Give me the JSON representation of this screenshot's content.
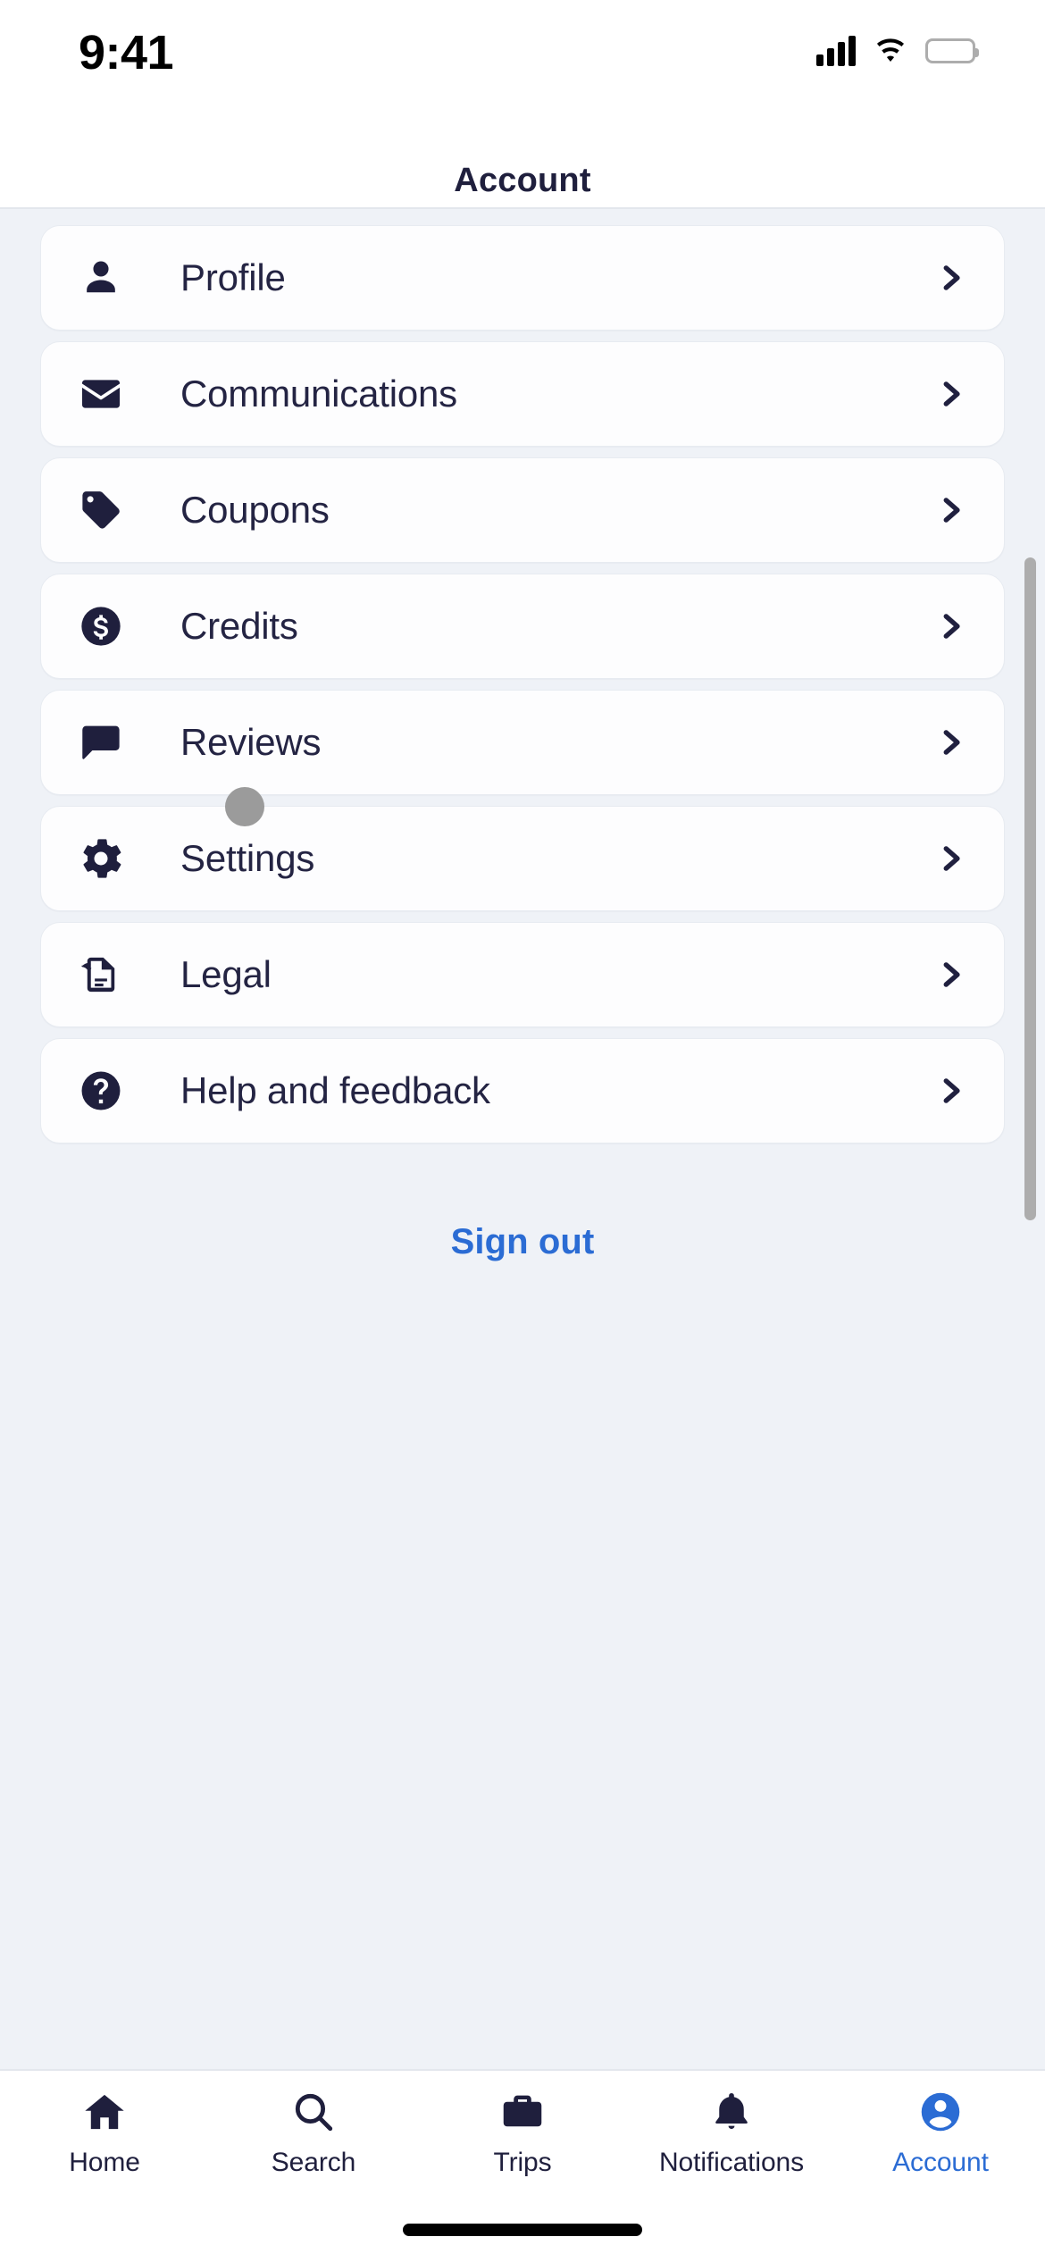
{
  "status_bar": {
    "time": "9:41",
    "signal_icon": "cellular-signal-icon",
    "wifi_icon": "wifi-icon",
    "battery_icon": "battery-full-icon"
  },
  "header": {
    "title": "Account"
  },
  "colors": {
    "accent_blue": "#2b6cd4",
    "ink_navy": "#1f1f3d",
    "page_bg": "#eff2f7",
    "card_bg": "#fdfdfe",
    "card_border": "#e7ebf1",
    "tap_indicator": "#9b9b9b"
  },
  "menu": {
    "items": [
      {
        "label": "Profile",
        "icon": "person-icon",
        "chevron": "chevron-right-icon"
      },
      {
        "label": "Communications",
        "icon": "envelope-icon",
        "chevron": "chevron-right-icon"
      },
      {
        "label": "Coupons",
        "icon": "price-tag-icon",
        "chevron": "chevron-right-icon"
      },
      {
        "label": "Credits",
        "icon": "dollar-circle-icon",
        "chevron": "chevron-right-icon"
      },
      {
        "label": "Reviews",
        "icon": "speech-bubble-icon",
        "chevron": "chevron-right-icon"
      },
      {
        "label": "Settings",
        "icon": "gear-icon",
        "chevron": "chevron-right-icon"
      },
      {
        "label": "Legal",
        "icon": "policy-document-icon",
        "chevron": "chevron-right-icon"
      },
      {
        "label": "Help and feedback",
        "icon": "question-circle-icon",
        "chevron": "chevron-right-icon"
      }
    ]
  },
  "sign_out": {
    "label": "Sign out"
  },
  "tab_bar": {
    "active_index": 4,
    "items": [
      {
        "label": "Home",
        "icon": "home-icon"
      },
      {
        "label": "Search",
        "icon": "search-icon"
      },
      {
        "label": "Trips",
        "icon": "briefcase-icon"
      },
      {
        "label": "Notifications",
        "icon": "bell-icon"
      },
      {
        "label": "Account",
        "icon": "account-circle-icon"
      }
    ]
  }
}
